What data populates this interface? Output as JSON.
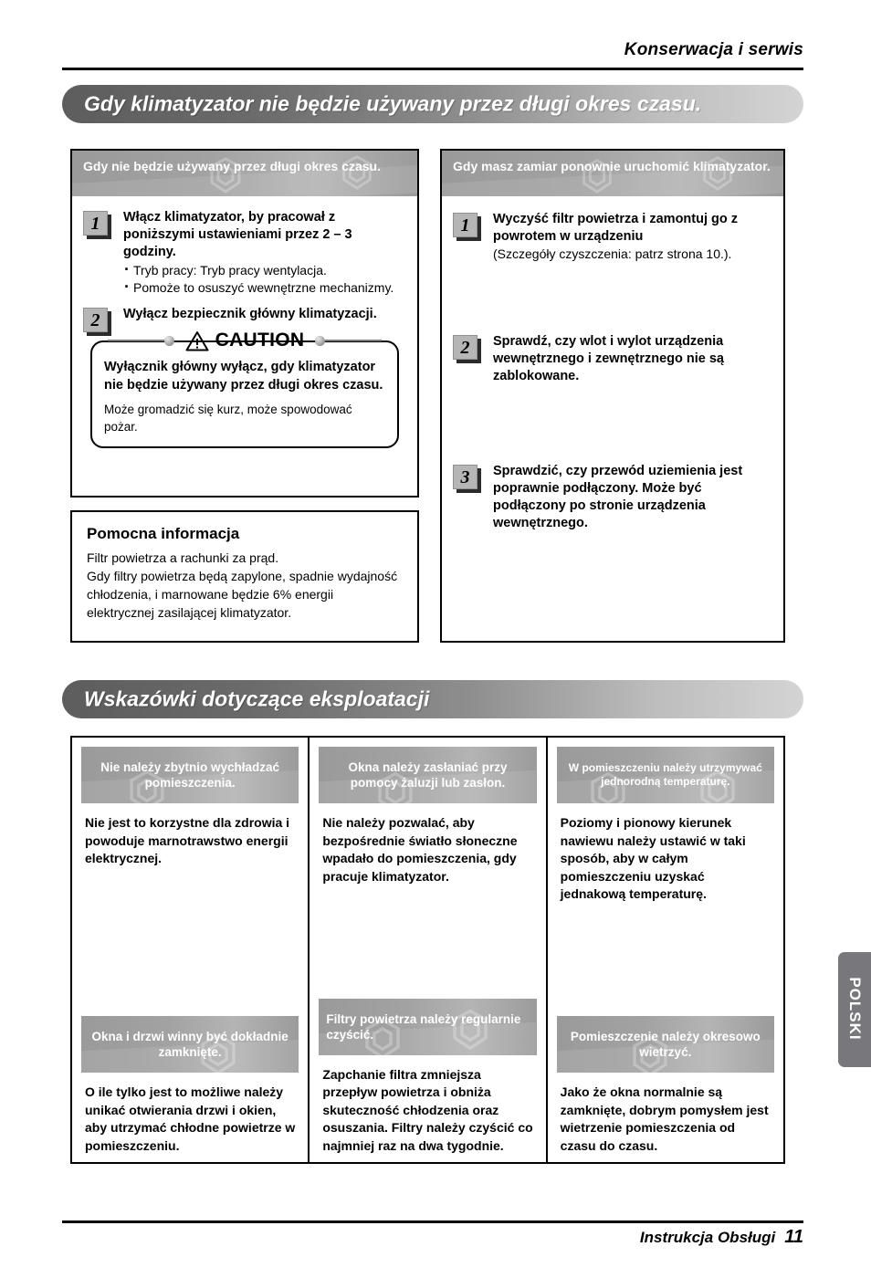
{
  "header": {
    "title": "Konserwacja i serwis"
  },
  "sections": [
    {
      "pill_title": "Gdy klimatyzator nie będzie używany przez długi okres czasu.",
      "left_panel": {
        "heading": "Gdy nie będzie używany przez długi okres czasu.",
        "steps": [
          {
            "number": "1",
            "title": "Włącz klimatyzator, by pracował z poniższymi ustawieniami przez 2 – 3 godziny.",
            "bullets": [
              "Tryb pracy: Tryb pracy wentylacja.",
              "Pomoże to osuszyć wewnętrzne mechanizmy."
            ]
          },
          {
            "number": "2",
            "title": "Wyłącz bezpiecznik główny klimatyzacji.",
            "bullets": []
          }
        ],
        "caution": {
          "label": "CAUTION",
          "icon": "warning-triangle-icon",
          "strong": "Wyłącznik główny wyłącz, gdy klimatyzator nie będzie używany przez długi okres czasu.",
          "note": "Może gromadzić się kurz, może spowodować pożar."
        }
      },
      "help": {
        "title": "Pomocna informacja",
        "body": "Filtr powietrza a rachunki za prąd.\nGdy filtry powietrza będą zapylone, spadnie wydajność chłodzenia, i marnowane będzie 6% energii elektrycznej zasilającej klimatyzator."
      },
      "right_panel": {
        "heading": "Gdy masz zamiar ponownie uruchomić klimatyzator.",
        "steps": [
          {
            "number": "1",
            "title": "Wyczyść filtr powietrza i zamontuj go z powrotem w urządzeniu",
            "sub": "(Szczegóły czyszczenia: patrz strona 10.)."
          },
          {
            "number": "2",
            "title": "Sprawdź, czy wlot i wylot urządzenia wewnętrznego i zewnętrznego nie są zablokowane.",
            "sub": ""
          },
          {
            "number": "3",
            "title": "Sprawdzić, czy przewód uziemienia jest poprawnie podłączony. Może być podłączony po stronie urządzenia wewnętrznego.",
            "sub": ""
          }
        ]
      }
    }
  ],
  "tips_section": {
    "pill_title": "Wskazówki dotyczące eksploatacji",
    "columns": [
      {
        "top": {
          "heading": "Nie należy zbytnio wychładzać pomieszczenia.",
          "heading_align": "center",
          "heading_size": "normal",
          "body": "Nie jest to korzystne dla zdrowia i powoduje marnotrawstwo energii elektrycznej."
        },
        "bottom": {
          "heading": "Okna i drzwi winny być dokładnie zamknięte.",
          "heading_align": "center",
          "heading_size": "normal",
          "body": "O ile tylko jest to możliwe należy unikać otwierania drzwi i okien, aby utrzymać chłodne powietrze w pomieszczeniu."
        }
      },
      {
        "top": {
          "heading": "Okna należy zasłaniać przy pomocy żaluzji lub zasłon.",
          "heading_align": "center",
          "heading_size": "normal",
          "body": "Nie należy pozwalać, aby bezpośrednie światło słoneczne wpadało do pomieszczenia, gdy pracuje klimatyzator."
        },
        "bottom": {
          "heading": "Filtry powietrza należy regularnie czyścić.",
          "heading_align": "left",
          "heading_size": "normal",
          "body": "Zapchanie filtra zmniejsza przepływ powietrza i obniża skuteczność chłodzenia oraz osuszania. Filtry należy czyścić co najmniej raz na dwa tygodnie."
        }
      },
      {
        "top": {
          "heading": "W pomieszczeniu należy utrzymywać jednorodną temperaturę.",
          "heading_align": "center",
          "heading_size": "small",
          "body": "Poziomy i pionowy kierunek nawiewu należy ustawić w taki sposób, aby w całym pomieszczeniu uzyskać jednakową temperaturę."
        },
        "bottom": {
          "heading": "Pomieszczenie należy okresowo wietrzyć.",
          "heading_align": "center",
          "heading_size": "normal",
          "body": "Jako że okna normalnie są zamknięte, dobrym pomysłem jest wietrzenie pomieszczenia od czasu do czasu."
        }
      }
    ]
  },
  "side_tab": {
    "label": "POLSKI"
  },
  "footer": {
    "manual_label": "Instrukcja Obsługi",
    "page_number": "11"
  },
  "colors": {
    "pill_dark": "#5d5d5d",
    "pill_light": "#d4d4d4",
    "subhead_gray": "#a2a2a2",
    "side_tab_gray": "#77777c",
    "rule_black": "#000000"
  }
}
